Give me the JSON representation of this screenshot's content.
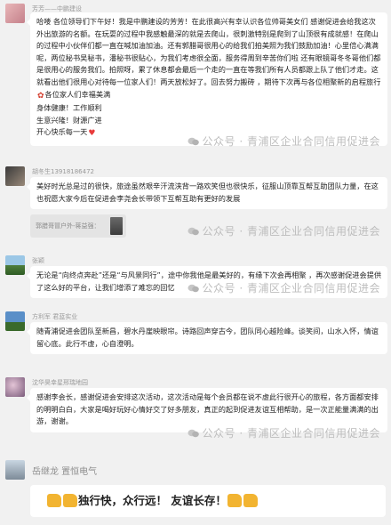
{
  "watermark": "公众号 · 青浦区企业合同信用促进会",
  "messages": [
    {
      "sender": "芳芳——中鹏建设",
      "paragraphs": [
        "哈喽 各位领导们下午好！我是中鹏建设的芳芳！在此很高兴有幸认识各位帅哥美女们 感谢促进会给我这次外出旅游的名额。在玩耍的过程中我感触最深的就是去爬山，很刺激特别是爬到了山顶很有成就感！在爬山的过程中小伙伴们都一直在喊加油加油。还有郭腊哥很用心的给我们拍美照为我们鼓励加油！心里倍心满满呢，两位秘书吴秘书，潘秘书很贴心，为我们考虑很全面，服务得周到辛苦你们啦 还有眼镜哥冬冬哥他们都是很用心的服务我们。拍照呀，累了休息都会最后一个走的一直在等我们所有人员都跟上队了他们才走。这就看出他们很用心对待每一位家人们！两天放松好了。回去努力搬砖 ，期待下次再与各位相聚新的启程旅行",
        "各位家人们幸福美满",
        "身体健康！工作顺利",
        "生意兴隆！财源广进",
        "开心快乐每一天"
      ]
    },
    {
      "sender": "胡冬生13918186472",
      "paragraphs": [
        "美好时光总是过的很快，旅途虽然艰辛汗流浃背一路欢笑但也很快乐，征服山顶靠互帮互助团队力量，在这也祝愿大家今后在促进会李尧会长带领下互帮互助有更好的发展"
      ],
      "quote": "郭腊哥冒户外-蒋益强："
    },
    {
      "sender": "张颖",
      "paragraphs": [
        "无论是“向终点奔赴”还是“与风景同行”，途中你我他是最美好的，有缘下次会再相聚 ，再次感谢促进会提供了这么好的平台，让我们增添了难忘的回忆"
      ]
    },
    {
      "sender": "方利军 君蓝实业",
      "paragraphs": [
        "随青浦促进会团队至新昌，碧水丹崖映眼帘。诗路回声穿古今，团队同心越险峰。谈笑间，山水入怀，情谊留心底。此行不虚，心自澄明。"
      ]
    },
    {
      "sender": "沈华昊幸星邢瑞地园",
      "paragraphs": [
        "感谢李会长，感谢促进会安排这次活动，这次活动是每个会员都在说不虚此行很开心的旅程，各方面都安排的明明白白，大家是喝好玩好心情好交了好多朋友，真正的起到促进友谊互相帮助，是一次正能量满满的出游，谢谢。"
      ]
    },
    {
      "sender": "岳继龙 置恒电气",
      "paragraphs": [
        "独行快，众行远！ 友谊长存！"
      ]
    }
  ]
}
